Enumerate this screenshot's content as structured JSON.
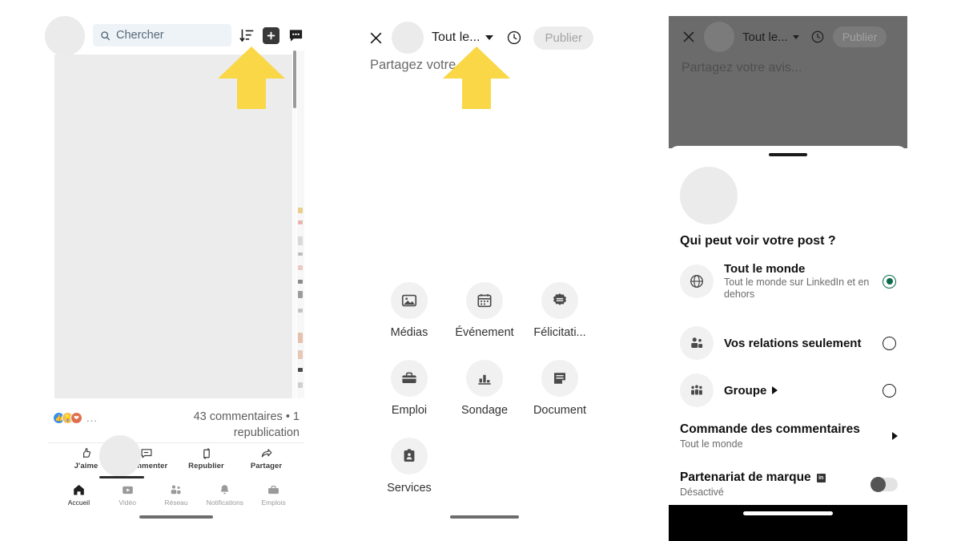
{
  "feed": {
    "search": {
      "placeholder": "Chercher",
      "icon": "search-icon"
    },
    "topbar_icons": [
      {
        "name": "sort-icon",
        "label": "Trier"
      },
      {
        "name": "plus-icon",
        "label": "Créer une publication"
      },
      {
        "name": "messaging-icon",
        "label": "Messagerie"
      }
    ],
    "reactions": [
      {
        "name": "reaction-like",
        "color": "#378fe9"
      },
      {
        "name": "reaction-insightful",
        "color": "#f5bb5c"
      },
      {
        "name": "reaction-love",
        "color": "#df704d"
      }
    ],
    "reactions_more": "...",
    "counts": "43 commentaires • 1 republication",
    "actions": [
      {
        "label": "J'aime",
        "icon": "thumbs-up-icon"
      },
      {
        "label": "Commenter",
        "icon": "comment-icon"
      },
      {
        "label": "Republier",
        "icon": "repost-icon"
      },
      {
        "label": "Partager",
        "icon": "share-icon"
      }
    ],
    "nav": [
      {
        "label": "Accueil",
        "icon": "home-icon",
        "active": true
      },
      {
        "label": "Vidéo",
        "icon": "video-icon",
        "active": false
      },
      {
        "label": "Réseau",
        "icon": "network-icon",
        "active": false
      },
      {
        "label": "Notifications",
        "icon": "bell-icon",
        "active": false
      },
      {
        "label": "Emplois",
        "icon": "briefcase-icon",
        "active": false
      }
    ]
  },
  "composer": {
    "close_label": "Fermer",
    "audience_label": "Tout le...",
    "clock_label": "Programmer",
    "publish_label": "Publier",
    "placeholder": "Partagez votre avis...",
    "grid": [
      {
        "label": "Médias",
        "icon": "image-icon"
      },
      {
        "label": "Événement",
        "icon": "calendar-icon"
      },
      {
        "label": "Félicitati...",
        "icon": "celebrate-icon"
      },
      {
        "label": "Emploi",
        "icon": "briefcase-icon"
      },
      {
        "label": "Sondage",
        "icon": "poll-icon"
      },
      {
        "label": "Document",
        "icon": "document-icon"
      },
      {
        "label": "Services",
        "icon": "services-icon"
      }
    ]
  },
  "sheet": {
    "scrim": {
      "close_label": "Fermer",
      "audience_label": "Tout le...",
      "clock_label": "Programmer",
      "publish_label": "Publier",
      "placeholder": "Partagez votre avis..."
    },
    "title": "Qui peut voir votre post ?",
    "options": [
      {
        "title": "Tout le monde",
        "subtitle": "Tout le monde sur LinkedIn et en dehors",
        "icon": "globe-icon",
        "selected": true
      },
      {
        "title": "Vos relations seulement",
        "subtitle": "",
        "icon": "connections-icon",
        "selected": false
      },
      {
        "title": "Groupe",
        "subtitle": "",
        "icon": "group-icon",
        "selected": false,
        "has_chevron": true
      }
    ],
    "settings": [
      {
        "title": "Commande des commentaires",
        "subtitle": "Tout le monde",
        "control": "chevron"
      },
      {
        "title": "Partenariat de marque",
        "badge": "in",
        "subtitle": "Désactivé",
        "control": "toggle",
        "toggle_on": false
      }
    ]
  },
  "annotations": {
    "arrow_color": "#f9d746",
    "arrows": [
      {
        "name": "arrow-pointing-to-plus-button"
      },
      {
        "name": "arrow-pointing-to-audience-selector"
      }
    ]
  }
}
